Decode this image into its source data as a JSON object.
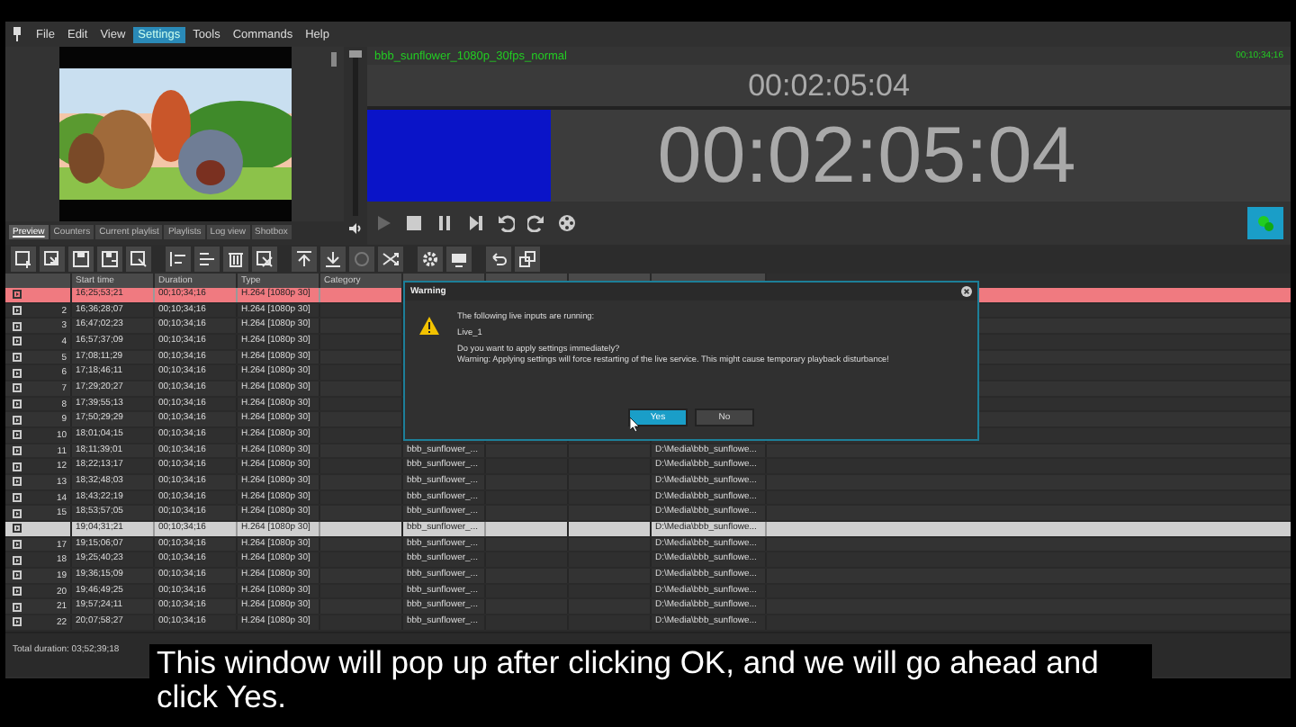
{
  "menu": [
    {
      "label": "File",
      "selected": false
    },
    {
      "label": "Edit",
      "selected": false
    },
    {
      "label": "View",
      "selected": false
    },
    {
      "label": "Settings",
      "selected": true
    },
    {
      "label": "Tools",
      "selected": false
    },
    {
      "label": "Commands",
      "selected": false
    },
    {
      "label": "Help",
      "selected": false
    }
  ],
  "preview_tabs": [
    {
      "label": "Preview",
      "selected": true
    },
    {
      "label": "Counters",
      "selected": false
    },
    {
      "label": "Current playlist",
      "selected": false
    },
    {
      "label": "Playlists",
      "selected": false
    },
    {
      "label": "Log view",
      "selected": false
    },
    {
      "label": "Shotbox",
      "selected": false
    }
  ],
  "volume": {
    "level": 1
  },
  "player": {
    "title": "bbb_sunflower_1080p_30fps_normal",
    "duration": "00;10;34;16",
    "small_clock": "00:02:05:04",
    "big_clock": "00:02:05:04"
  },
  "table": {
    "columns": [
      "Start time",
      "Duration",
      "Type",
      "Category"
    ],
    "rows": [
      {
        "number": "",
        "start": "16;25;53;21",
        "duration": "00;10;34;16",
        "type": "H.264 [1080p 30]",
        "playing": true,
        "selected": false
      },
      {
        "number": "2",
        "start": "16;36;28;07",
        "duration": "00;10;34;16",
        "type": "H.264 [1080p 30]",
        "playing": false,
        "selected": false
      },
      {
        "number": "3",
        "start": "16;47;02;23",
        "duration": "00;10;34;16",
        "type": "H.264 [1080p 30]",
        "playing": false,
        "selected": false
      },
      {
        "number": "4",
        "start": "16;57;37;09",
        "duration": "00;10;34;16",
        "type": "H.264 [1080p 30]",
        "playing": false,
        "selected": false
      },
      {
        "number": "5",
        "start": "17;08;11;29",
        "duration": "00;10;34;16",
        "type": "H.264 [1080p 30]",
        "playing": false,
        "selected": false
      },
      {
        "number": "6",
        "start": "17;18;46;11",
        "duration": "00;10;34;16",
        "type": "H.264 [1080p 30]",
        "playing": false,
        "selected": false
      },
      {
        "number": "7",
        "start": "17;29;20;27",
        "duration": "00;10;34;16",
        "type": "H.264 [1080p 30]",
        "playing": false,
        "selected": false
      },
      {
        "number": "8",
        "start": "17;39;55;13",
        "duration": "00;10;34;16",
        "type": "H.264 [1080p 30]",
        "playing": false,
        "selected": false
      },
      {
        "number": "9",
        "start": "17;50;29;29",
        "duration": "00;10;34;16",
        "type": "H.264 [1080p 30]",
        "playing": false,
        "selected": false
      },
      {
        "number": "10",
        "start": "18;01;04;15",
        "duration": "00;10;34;16",
        "type": "H.264 [1080p 30]",
        "playing": false,
        "selected": false
      },
      {
        "number": "11",
        "start": "18;11;39;01",
        "duration": "00;10;34;16",
        "type": "H.264 [1080p 30]",
        "name": "bbb_sunflower_...",
        "path": "D:\\Media\\bbb_sunflowe...",
        "playing": false,
        "selected": false
      },
      {
        "number": "12",
        "start": "18;22;13;17",
        "duration": "00;10;34;16",
        "type": "H.264 [1080p 30]",
        "name": "bbb_sunflower_...",
        "path": "D:\\Media\\bbb_sunflowe...",
        "playing": false,
        "selected": false
      },
      {
        "number": "13",
        "start": "18;32;48;03",
        "duration": "00;10;34;16",
        "type": "H.264 [1080p 30]",
        "name": "bbb_sunflower_...",
        "path": "D:\\Media\\bbb_sunflowe...",
        "playing": false,
        "selected": false
      },
      {
        "number": "14",
        "start": "18;43;22;19",
        "duration": "00;10;34;16",
        "type": "H.264 [1080p 30]",
        "name": "bbb_sunflower_...",
        "path": "D:\\Media\\bbb_sunflowe...",
        "playing": false,
        "selected": false
      },
      {
        "number": "15",
        "start": "18;53;57;05",
        "duration": "00;10;34;16",
        "type": "H.264 [1080p 30]",
        "name": "bbb_sunflower_...",
        "path": "D:\\Media\\bbb_sunflowe...",
        "playing": false,
        "selected": false
      },
      {
        "number": "",
        "start": "19;04;31;21",
        "duration": "00;10;34;16",
        "type": "H.264 [1080p 30]",
        "name": "bbb_sunflower_...",
        "path": "D:\\Media\\bbb_sunflowe...",
        "playing": false,
        "selected": true
      },
      {
        "number": "17",
        "start": "19;15;06;07",
        "duration": "00;10;34;16",
        "type": "H.264 [1080p 30]",
        "name": "bbb_sunflower_...",
        "path": "D:\\Media\\bbb_sunflowe...",
        "playing": false,
        "selected": false
      },
      {
        "number": "18",
        "start": "19;25;40;23",
        "duration": "00;10;34;16",
        "type": "H.264 [1080p 30]",
        "name": "bbb_sunflower_...",
        "path": "D:\\Media\\bbb_sunflowe...",
        "playing": false,
        "selected": false
      },
      {
        "number": "19",
        "start": "19;36;15;09",
        "duration": "00;10;34;16",
        "type": "H.264 [1080p 30]",
        "name": "bbb_sunflower_...",
        "path": "D:\\Media\\bbb_sunflowe...",
        "playing": false,
        "selected": false
      },
      {
        "number": "20",
        "start": "19;46;49;25",
        "duration": "00;10;34;16",
        "type": "H.264 [1080p 30]",
        "name": "bbb_sunflower_...",
        "path": "D:\\Media\\bbb_sunflowe...",
        "playing": false,
        "selected": false
      },
      {
        "number": "21",
        "start": "19;57;24;11",
        "duration": "00;10;34;16",
        "type": "H.264 [1080p 30]",
        "name": "bbb_sunflower_...",
        "path": "D:\\Media\\bbb_sunflowe...",
        "playing": false,
        "selected": false
      },
      {
        "number": "22",
        "start": "20;07;58;27",
        "duration": "00;10;34;16",
        "type": "H.264 [1080p 30]",
        "name": "bbb_sunflower_...",
        "path": "D:\\Media\\bbb_sunflowe...",
        "playing": false,
        "selected": false
      }
    ]
  },
  "footer": {
    "total_duration": "Total duration: 03;52;39;18"
  },
  "dialog": {
    "title": "Warning",
    "lines": [
      "The following live inputs are running:",
      "Live_1",
      "Do you want to apply settings immediately?",
      "Warning: Applying settings will force restarting of the live service. This might cause temporary playback disturbance!"
    ],
    "buttons": [
      {
        "label": "Yes",
        "selected": true
      },
      {
        "label": "No",
        "selected": false
      }
    ]
  },
  "caption": "This window will pop up after clicking OK, and we will go ahead and click Yes."
}
